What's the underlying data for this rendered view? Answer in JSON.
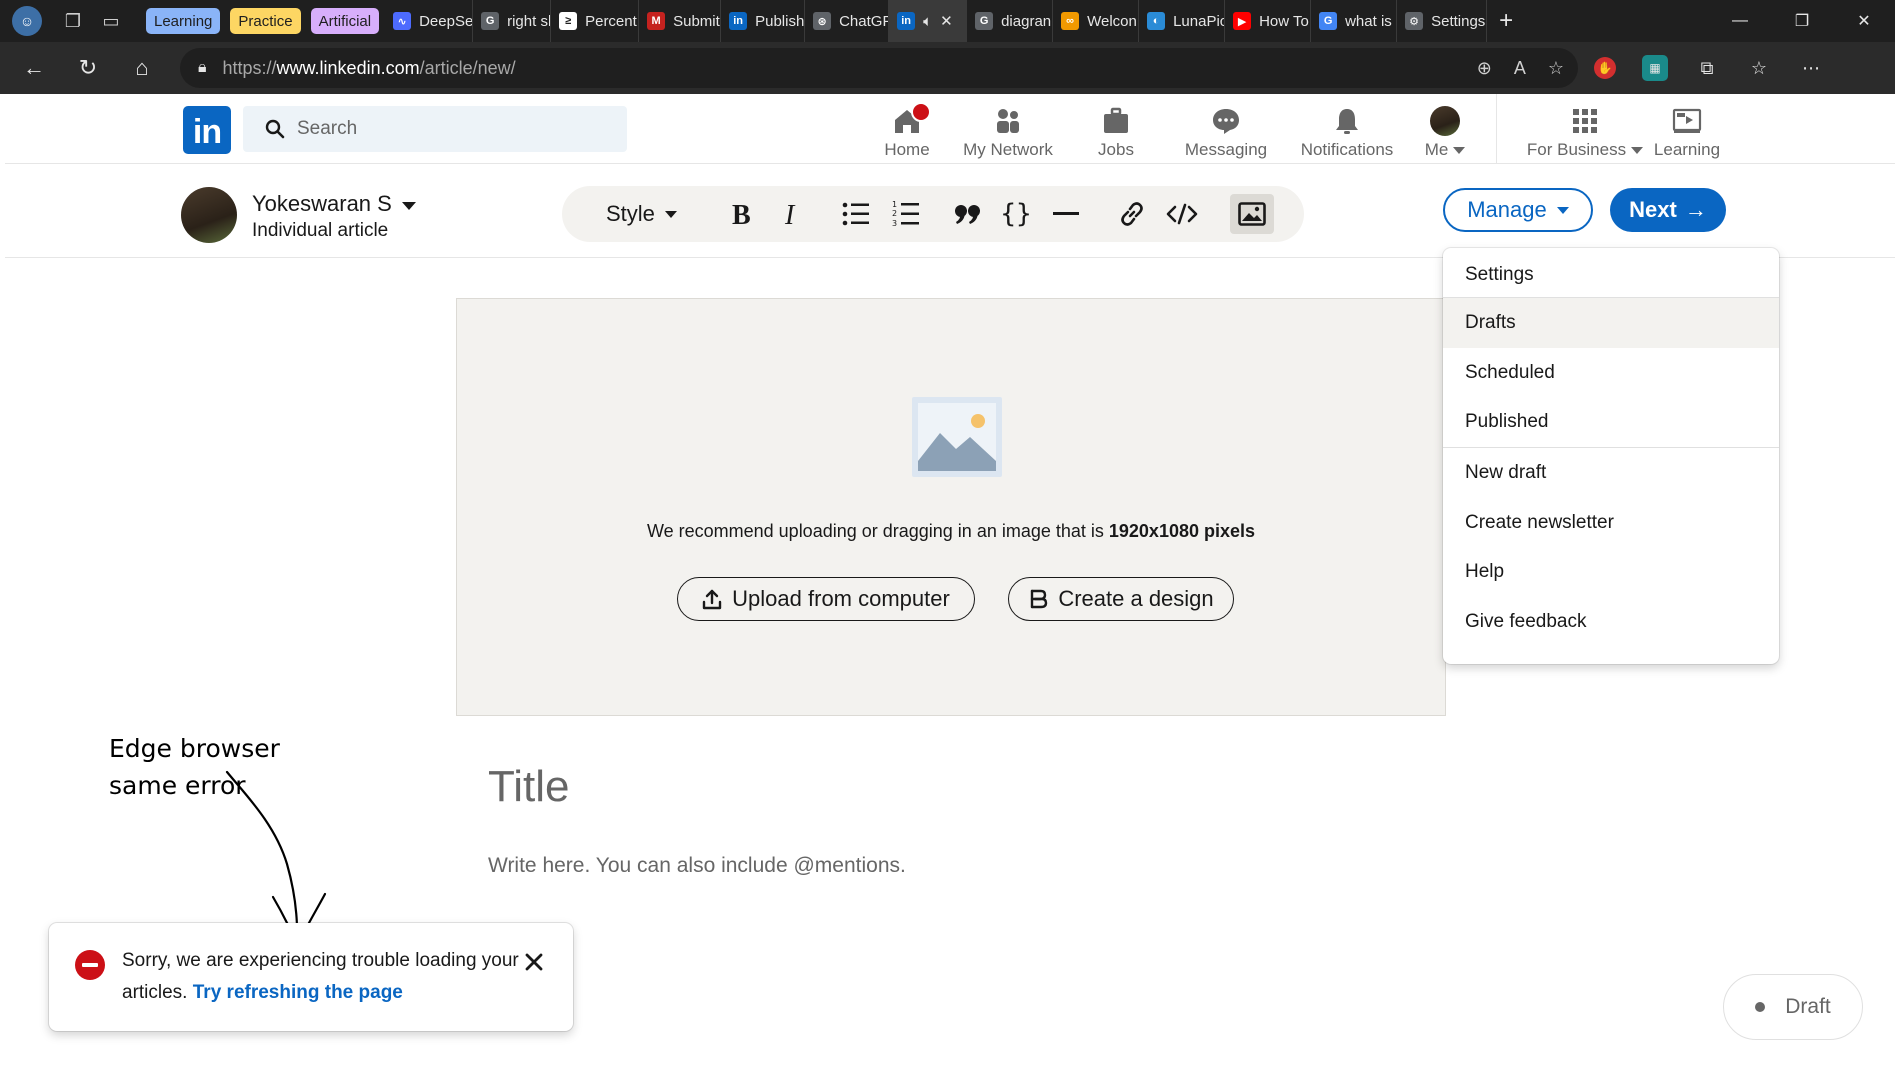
{
  "browser": {
    "tab_groups": [
      {
        "label": "Learning",
        "color": "#8ab4f8"
      },
      {
        "label": "Practice",
        "color": "#fdd663"
      },
      {
        "label": "Artificial",
        "color": "#d7aefb"
      }
    ],
    "tabs": [
      {
        "label": "DeepSe",
        "icon": "deepseek-icon",
        "color": "#4d6bfe",
        "glyph": "∿"
      },
      {
        "label": "right sk",
        "icon": "google-icon",
        "color": "#5f6368",
        "glyph": "G"
      },
      {
        "label": "Percent",
        "icon": "perplexity-icon",
        "color": "#ffffff",
        "glyph": "≥"
      },
      {
        "label": "Submit",
        "icon": "gmail-icon",
        "color": "#c5221f",
        "glyph": "M"
      },
      {
        "label": "Publish",
        "icon": "linkedin-icon",
        "color": "#0a66c2",
        "glyph": "in"
      },
      {
        "label": "ChatGP",
        "icon": "chatgpt-icon",
        "color": "#5f6368",
        "glyph": "⊛"
      },
      {
        "label": "",
        "icon": "linkedin-icon",
        "color": "#0a66c2",
        "glyph": "in",
        "active": true
      },
      {
        "label": "diagran",
        "icon": "google-icon",
        "color": "#5f6368",
        "glyph": "G"
      },
      {
        "label": "Welcon",
        "icon": "coursera-icon",
        "color": "#f29900",
        "glyph": "∞"
      },
      {
        "label": "LunaPic",
        "icon": "lunapic-icon",
        "color": "#2a8bd6",
        "glyph": "◐"
      },
      {
        "label": "How To",
        "icon": "youtube-icon",
        "color": "#ff0000",
        "glyph": "▶"
      },
      {
        "label": "what is",
        "icon": "google-icon",
        "color": "#4285f4",
        "glyph": "G"
      },
      {
        "label": "Settings",
        "icon": "gear-icon",
        "color": "#5f6368",
        "glyph": "⚙"
      }
    ],
    "url_prefix": "https://",
    "url_host": "www.linkedin.com",
    "url_path": "/article/new/"
  },
  "nav": {
    "search_placeholder": "Search",
    "items": [
      {
        "label": "Home"
      },
      {
        "label": "My Network"
      },
      {
        "label": "Jobs"
      },
      {
        "label": "Messaging"
      },
      {
        "label": "Notifications"
      },
      {
        "label": "Me"
      },
      {
        "label": "For Business"
      },
      {
        "label": "Learning"
      }
    ]
  },
  "editor": {
    "author_name": "Yokeswaran S",
    "author_subtitle": "Individual article",
    "toolbar": {
      "style_label": "Style"
    },
    "manage_label": "Manage",
    "next_label": "Next",
    "cover_recommend_prefix": "We recommend uploading or dragging in an image that is ",
    "cover_recommend_size": "1920x1080 pixels",
    "upload_label": "Upload from computer",
    "design_label": "Create a design",
    "title_placeholder": "Title",
    "body_placeholder": "Write here. You can also include @mentions."
  },
  "manage_menu": {
    "items": [
      {
        "label": "Settings"
      },
      {
        "label": "Drafts"
      },
      {
        "label": "Scheduled"
      },
      {
        "label": "Published"
      },
      {
        "label": "New draft"
      },
      {
        "label": "Create newsletter"
      },
      {
        "label": "Help"
      },
      {
        "label": "Give feedback"
      }
    ]
  },
  "annotation": {
    "line1": "Edge browser",
    "line2": "same error"
  },
  "toast": {
    "message": "Sorry, we are experiencing trouble loading your articles.",
    "link": "Try refreshing the page"
  },
  "status": {
    "draft_label": "Draft"
  }
}
